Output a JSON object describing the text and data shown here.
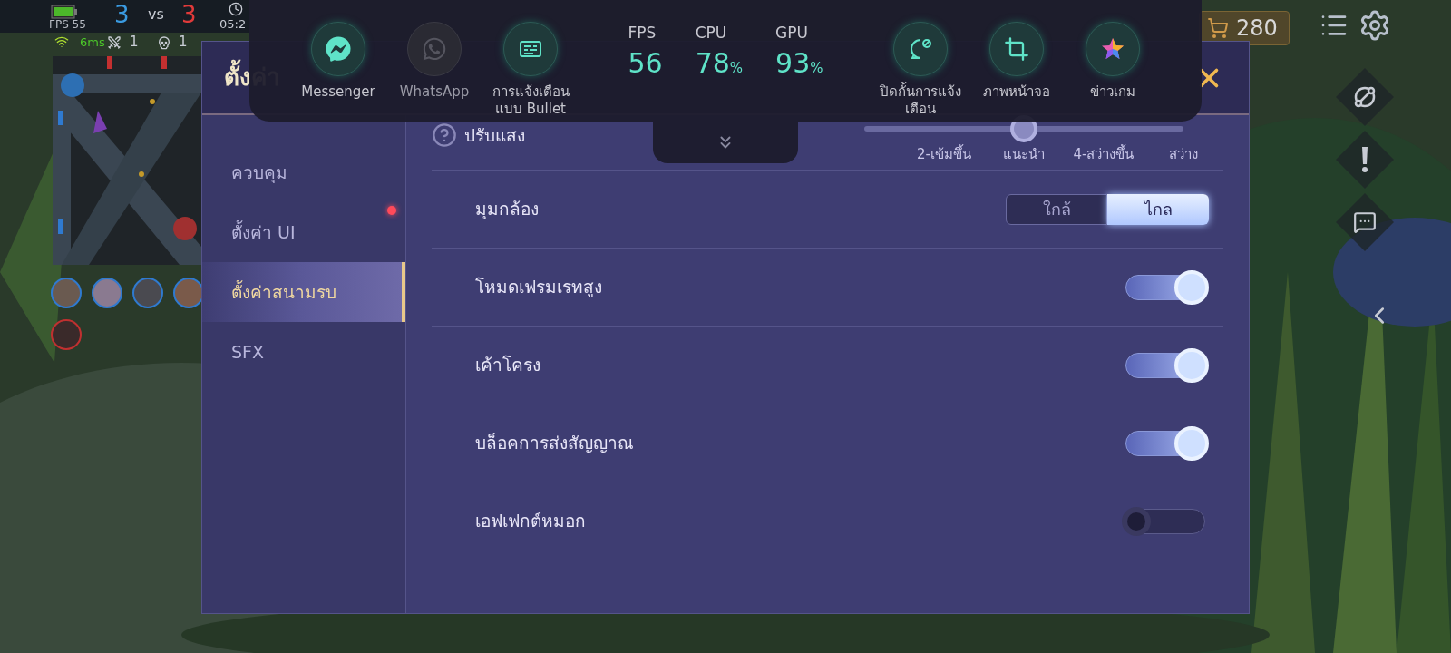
{
  "hud": {
    "fps": "FPS 55",
    "score_blue": "3",
    "vs": "vs",
    "score_red": "3",
    "time": "05:2",
    "ping": "6ms",
    "kills": "1",
    "deaths": "1",
    "gold": "280"
  },
  "settings": {
    "title": "ตั้งค่า",
    "sidebar": [
      {
        "label": "ควบคุม",
        "selected": false,
        "badge": false
      },
      {
        "label": "ตั้งค่า UI",
        "selected": false,
        "badge": true
      },
      {
        "label": "ตั้งค่าสนามรบ",
        "selected": true,
        "badge": false
      },
      {
        "label": "SFX",
        "selected": false,
        "badge": false
      }
    ],
    "rows": [
      {
        "kind": "slider",
        "label": "ปรับแสง",
        "level": 0.5,
        "stops": [
          "2-เข้มขึ้น",
          "แนะนำ",
          "4-สว่างขึ้น",
          "สว่าง"
        ]
      },
      {
        "kind": "segmented",
        "label": "มุมกล้อง",
        "options": [
          {
            "label": "ใกล้",
            "selected": false
          },
          {
            "label": "ไกล",
            "selected": true
          }
        ]
      },
      {
        "kind": "toggle",
        "label": "โหมดเฟรมเรทสูง",
        "on": true
      },
      {
        "kind": "toggle",
        "label": "เค้าโครง",
        "on": true
      },
      {
        "kind": "toggle",
        "label": "บล็อคการส่งสัญญาณ",
        "on": true
      },
      {
        "kind": "toggle",
        "label": "เอฟเฟกต์หมอก",
        "on": false
      }
    ]
  },
  "overlay": {
    "apps_left": [
      {
        "kind": "messenger",
        "label": "Messenger",
        "disabled": false
      },
      {
        "kind": "whatsapp",
        "label": "WhatsApp",
        "disabled": true
      },
      {
        "kind": "bullet",
        "label": "การแจ้งเตือน\nแบบ Bullet",
        "disabled": false
      }
    ],
    "stats": [
      {
        "label": "FPS",
        "value": "56"
      },
      {
        "label": "CPU",
        "value": "78",
        "unit": "%"
      },
      {
        "label": "GPU",
        "value": "93",
        "unit": "%"
      }
    ],
    "apps_right": [
      {
        "kind": "block",
        "label": "ปิดกั้นการแจ้ง\nเตือน",
        "disabled": false
      },
      {
        "kind": "screenshot",
        "label": "ภาพหน้าจอ",
        "disabled": false
      },
      {
        "kind": "news",
        "label": "ข่าวเกม",
        "disabled": false
      }
    ]
  }
}
